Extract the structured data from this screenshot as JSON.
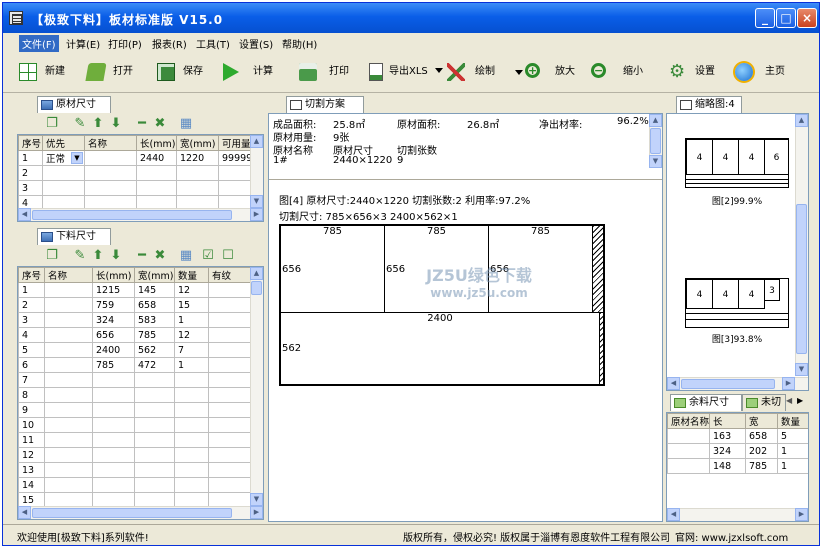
{
  "window": {
    "title": "【极致下料】板材标准版 V15.0",
    "min": "_",
    "max": "□",
    "close": "×"
  },
  "menu": [
    "文件(F)",
    "计算(E)",
    "打印(P)",
    "报表(R)",
    "工具(T)",
    "设置(S)",
    "帮助(H)"
  ],
  "toolbar": {
    "new": "新建",
    "open": "打开",
    "save": "保存",
    "calc": "计算",
    "print": "打印",
    "export": "导出XLS",
    "draw": "绘制",
    "zoom_in": "放大",
    "zoom_out": "缩小",
    "settings": "设置",
    "home": "主页"
  },
  "raw_panel": {
    "tab": "原材尺寸",
    "headers": [
      "序号",
      "优先",
      "名称",
      "长(mm)",
      "宽(mm)",
      "可用量"
    ],
    "rows": [
      [
        "1",
        "正常",
        "",
        "2440",
        "1220",
        "99999"
      ],
      [
        "2",
        "",
        "",
        "",
        "",
        ""
      ],
      [
        "3",
        "",
        "",
        "",
        "",
        ""
      ],
      [
        "4",
        "",
        "",
        "",
        "",
        ""
      ]
    ]
  },
  "part_panel": {
    "tab": "下料尺寸",
    "headers": [
      "序号",
      "名称",
      "长(mm)",
      "宽(mm)",
      "数量",
      "有纹"
    ],
    "rows": [
      [
        "1",
        "",
        "1215",
        "145",
        "12",
        ""
      ],
      [
        "2",
        "",
        "759",
        "658",
        "15",
        ""
      ],
      [
        "3",
        "",
        "324",
        "583",
        "1",
        ""
      ],
      [
        "4",
        "",
        "656",
        "785",
        "12",
        ""
      ],
      [
        "5",
        "",
        "2400",
        "562",
        "7",
        ""
      ],
      [
        "6",
        "",
        "785",
        "472",
        "1",
        ""
      ],
      [
        "7",
        "",
        "",
        "",
        "",
        ""
      ],
      [
        "8",
        "",
        "",
        "",
        "",
        ""
      ],
      [
        "9",
        "",
        "",
        "",
        "",
        ""
      ],
      [
        "10",
        "",
        "",
        "",
        "",
        ""
      ],
      [
        "11",
        "",
        "",
        "",
        "",
        ""
      ],
      [
        "12",
        "",
        "",
        "",
        "",
        ""
      ],
      [
        "13",
        "",
        "",
        "",
        "",
        ""
      ],
      [
        "14",
        "",
        "",
        "",
        "",
        ""
      ],
      [
        "15",
        "",
        "",
        "",
        "",
        ""
      ]
    ]
  },
  "plan": {
    "tab": "切割方案",
    "summary": {
      "prod_area_label": "成品面积:",
      "prod_area": "25.8㎡",
      "raw_area_label": "原材面积:",
      "raw_area": "26.8㎡",
      "yield_label": "净出材率:",
      "yield": "96.2%",
      "usage_label": "原材用量:",
      "usage": "9张",
      "h_name": "原材名称",
      "h_size": "原材尺寸",
      "h_count": "切割张数",
      "r_name": "1#",
      "r_size": "2440×1220",
      "r_count": "9"
    },
    "info1": "图[4] 原材尺寸:2440×1220  切割张数:2  利用率:97.2%",
    "info2": "切割尺寸: 785×656×3  2400×562×1",
    "top_parts": [
      {
        "w": "785",
        "h": "656"
      },
      {
        "w": "785",
        "h": "656"
      },
      {
        "w": "785",
        "h": "656"
      }
    ],
    "bottom_part": {
      "w": "2400",
      "h": "562"
    },
    "watermark1": "JZ5U绿色下载",
    "watermark2": "www.jz5u.com"
  },
  "preview": {
    "tab": "缩略图:4",
    "t1": {
      "cells": [
        "4",
        "4",
        "4",
        "6"
      ],
      "caption": "图[2]99.9%"
    },
    "t2": {
      "cells": [
        "4",
        "4",
        "4",
        "3"
      ],
      "caption": "图[3]93.8%"
    }
  },
  "remain": {
    "tab1": "余料尺寸",
    "tab2": "未切",
    "headers": [
      "原材名称",
      "长",
      "宽",
      "数量"
    ],
    "rows": [
      [
        "",
        "163",
        "658",
        "5"
      ],
      [
        "",
        "324",
        "202",
        "1"
      ],
      [
        "",
        "148",
        "785",
        "1"
      ]
    ]
  },
  "status": {
    "left": "欢迎使用[极致下料]系列软件!",
    "mid": "版权所有，侵权必究! 版权属于淄博有恩度软件工程有限公司",
    "right": "官网: www.jzxlsoft.com"
  }
}
